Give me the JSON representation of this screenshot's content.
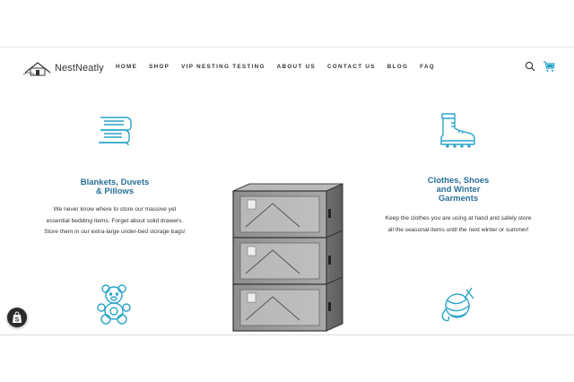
{
  "brand": {
    "name": "NestNeatly"
  },
  "nav": {
    "items": [
      "HOME",
      "SHOP",
      "VIP NESTING TESTING",
      "ABOUT US",
      "CONTACT US",
      "BLOG",
      "FAQ"
    ]
  },
  "icons": {
    "search": "search-icon",
    "cart": "cart-icon",
    "shopify": "shopify-badge-icon"
  },
  "colors": {
    "accent": "#2aa4c9",
    "title": "#2a6f97"
  },
  "features": [
    {
      "title_line1": "Blankets, Duvets",
      "title_line2": "& Pillows",
      "text_line1": "We never know where to store our massive yet",
      "text_line2": "essential bedding items. Forget about solid drawers.",
      "text_line3": "Store them in our extra-large under-bed storage bags!"
    },
    {
      "title_line1": "Clothes, Shoes",
      "title_line2": "and Winter",
      "title_line3": "Garments",
      "text_line1": "Keep the clothes you are using at hand and safely store",
      "text_line2": "all the seasonal items until the next winter or summer!"
    }
  ]
}
